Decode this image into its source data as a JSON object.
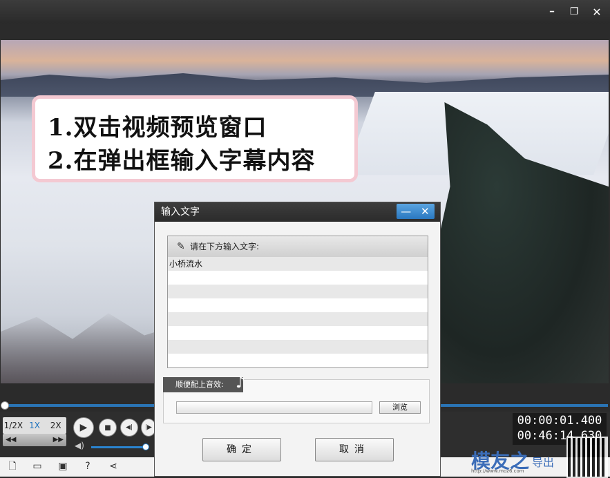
{
  "window": {
    "minimize": "━",
    "restore": "❐",
    "close": "✕"
  },
  "caption": {
    "line1": "1.双击视频预览窗口",
    "line2": "2.在弹出框输入字幕内容"
  },
  "player": {
    "speed": [
      "1/2X",
      "1X",
      "2X"
    ],
    "jog_left": "◀◀",
    "jog_right": "▶▶",
    "time_current": "00:00:01.400",
    "time_total": "00:46:14.630"
  },
  "dialog": {
    "title": "输入文字",
    "min": "—",
    "close": "✕",
    "prompt": "请在下方输入文字:",
    "lines": [
      "小桥流水",
      "",
      "",
      "",
      "",
      "",
      "",
      ""
    ],
    "music_label": "顺便配上音效:",
    "music_value": "",
    "browse": "浏览",
    "ok": "确定",
    "cancel": "取消"
  },
  "logo": {
    "text": "模友之",
    "sub": "导出",
    "url": "http://www.moz6.com"
  },
  "icons": [
    "new-file-icon",
    "open-folder-icon",
    "save-icon",
    "help-icon",
    "share-icon"
  ]
}
